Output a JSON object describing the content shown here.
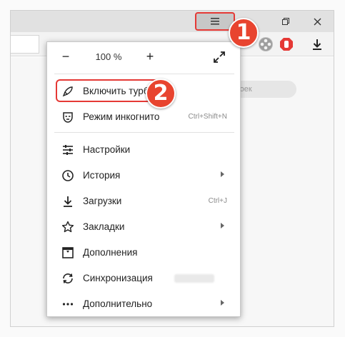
{
  "titlebar": {
    "menu_icon": "hamburger-icon",
    "restore_icon": "restore-window-icon",
    "close_icon": "close-window-icon"
  },
  "toolbar": {
    "extension_icons": [
      "film-reel-icon",
      "opera-adblock-icon"
    ],
    "download_icon": "download-icon"
  },
  "content": {
    "search_partial": "строек"
  },
  "menu": {
    "zoom": {
      "minus": "−",
      "value": "100 %",
      "plus": "+",
      "fullscreen_icon": "fullscreen-icon"
    },
    "items": [
      {
        "label": "Включить турбо",
        "icon": "rocket-icon"
      },
      {
        "label": "Режим инкогнито",
        "icon": "incognito-mask-icon",
        "shortcut": "Ctrl+Shift+N"
      },
      {
        "label": "Настройки",
        "icon": "settings-sliders-icon"
      },
      {
        "label": "История",
        "icon": "history-clock-icon",
        "submenu": true
      },
      {
        "label": "Загрузки",
        "icon": "download-arrow-icon",
        "shortcut": "Ctrl+J"
      },
      {
        "label": "Закладки",
        "icon": "star-icon",
        "submenu": true
      },
      {
        "label": "Дополнения",
        "icon": "extensions-box-icon"
      },
      {
        "label": "Синхронизация",
        "icon": "sync-icon"
      },
      {
        "label": "Дополнительно",
        "icon": "more-dots-icon",
        "submenu": true
      }
    ]
  },
  "annotations": {
    "badge_1": "1",
    "badge_2": "2",
    "color": "#e53935"
  }
}
